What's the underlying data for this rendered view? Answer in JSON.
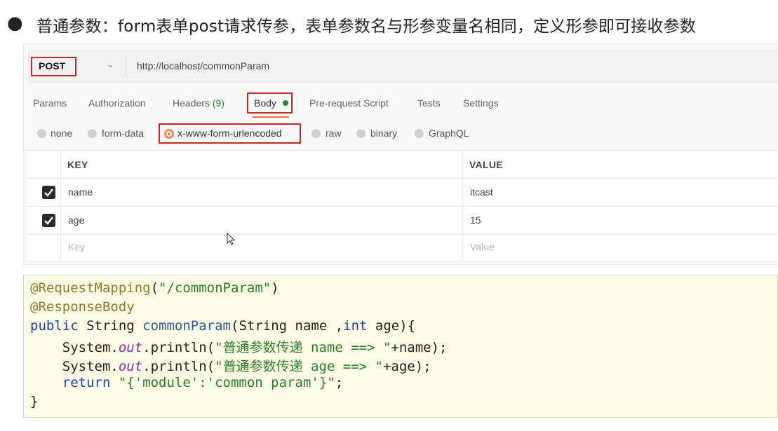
{
  "heading": {
    "bullet": "●",
    "text": "普通参数：form表单post请求传参，表单参数名与形参变量名相同，定义形参即可接收参数"
  },
  "request": {
    "method": "POST",
    "url": "http://localhost/commonParam"
  },
  "tabs": [
    {
      "label": "Params"
    },
    {
      "label": "Authorization"
    },
    {
      "label": "Headers",
      "count": "(9)"
    },
    {
      "label": "Body"
    },
    {
      "label": "Pre-request Script"
    },
    {
      "label": "Tests"
    },
    {
      "label": "Settings"
    }
  ],
  "body_types": [
    {
      "label": "none"
    },
    {
      "label": "form-data"
    },
    {
      "label": "x-www-form-urlencoded"
    },
    {
      "label": "raw"
    },
    {
      "label": "binary"
    },
    {
      "label": "GraphQL"
    }
  ],
  "table": {
    "key_header": "KEY",
    "value_header": "VALUE",
    "rows": [
      {
        "key": "name",
        "value": "itcast"
      },
      {
        "key": "age",
        "value": "15"
      }
    ],
    "placeholder_key": "Key",
    "placeholder_value": "Value"
  },
  "code": {
    "l1_anno": "@RequestMapping",
    "l1_p1": "(",
    "l1_str": "\"/commonParam\"",
    "l1_p2": ")",
    "l2_anno": "@ResponseBody",
    "l3_kw1": "public",
    "l3_t1": " String ",
    "l3_meth": "commonParam",
    "l3_t2": "(String name ,",
    "l3_kw2": "int",
    "l3_t3": " age){",
    "l4_t1": "    System.",
    "l4_fld": "out",
    "l4_t2": ".println(",
    "l4_str": "\"普通参数传递 name ==> \"",
    "l4_t3": "+name);",
    "l5_t1": "    System.",
    "l5_fld": "out",
    "l5_t2": ".println(",
    "l5_str": "\"普通参数传递 age ==> \"",
    "l5_t3": "+age);",
    "l6_kw": "    return",
    "l6_sp": " ",
    "l6_str": "\"{'module':'common param'}\"",
    "l6_t1": ";",
    "l7": "}"
  }
}
